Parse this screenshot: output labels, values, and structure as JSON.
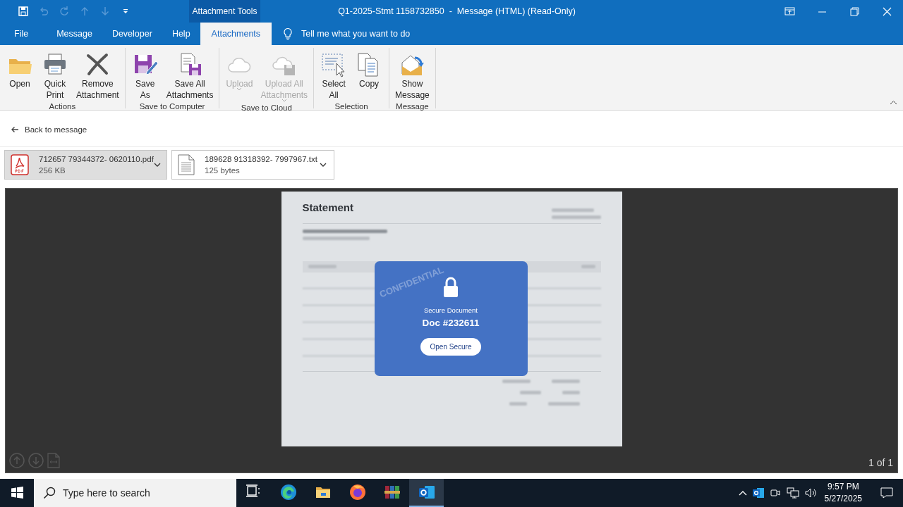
{
  "window": {
    "title": "Q1-2025-Stmt 1158732850  -  Message (HTML) (Read-Only)",
    "context_tab_group": "Attachment Tools"
  },
  "quick_access": [
    {
      "disabled": false
    },
    {
      "disabled": true
    },
    {
      "disabled": true
    },
    {
      "disabled": true
    },
    {
      "disabled": true
    },
    {
      "disabled": false
    }
  ],
  "tabs": [
    {
      "label": "File",
      "selected": false
    },
    {
      "label": "Message",
      "selected": false
    },
    {
      "label": "Developer",
      "selected": false
    },
    {
      "label": "Help",
      "selected": false
    },
    {
      "label": "Attachments",
      "selected": true
    }
  ],
  "tell_me": {
    "placeholder": "Tell me what you want to do"
  },
  "ribbon_groups": [
    {
      "label": "Actions",
      "buttons": [
        {
          "label": "Open",
          "disabled": false,
          "dropdown": false
        },
        {
          "label": "Quick Print",
          "disabled": false,
          "dropdown": false
        },
        {
          "label": "Remove Attachment",
          "disabled": false,
          "dropdown": false
        }
      ]
    },
    {
      "label": "Save to Computer",
      "buttons": [
        {
          "label": "Save As",
          "disabled": false,
          "dropdown": false
        },
        {
          "label": "Save All Attachments",
          "disabled": false,
          "dropdown": false
        }
      ]
    },
    {
      "label": "Save to Cloud",
      "buttons": [
        {
          "label": "Upload",
          "disabled": true,
          "dropdown": true
        },
        {
          "label": "Upload All Attachments",
          "disabled": true,
          "dropdown": true
        }
      ]
    },
    {
      "label": "Selection",
      "buttons": [
        {
          "label": "Select All",
          "disabled": false,
          "dropdown": false
        },
        {
          "label": "Copy",
          "disabled": false,
          "dropdown": false
        }
      ]
    },
    {
      "label": "Message",
      "buttons": [
        {
          "label": "Show Message",
          "disabled": false,
          "dropdown": false
        }
      ]
    }
  ],
  "back_link": "Back to message",
  "attachments": [
    {
      "kind": "pdf",
      "name": "712657 79344372- 0620110.pdf",
      "size": "256 KB",
      "selected": true
    },
    {
      "kind": "text",
      "name": "189628 91318392- 7997967.txt",
      "size": "125 bytes",
      "selected": false
    }
  ],
  "preview": {
    "document": {
      "title": "Statement",
      "watermark": "CONFIDENTIAL",
      "dialog": {
        "label": "Secure Document",
        "doc_number": "Doc #232611",
        "button": "Open Secure"
      }
    },
    "page_counter": "1 of 1"
  },
  "taskbar": {
    "search": {
      "placeholder": "Type here to search"
    },
    "apps": [
      {
        "selected": false
      },
      {
        "selected": false
      },
      {
        "selected": false
      },
      {
        "selected": false
      },
      {
        "selected": false
      },
      {
        "selected": true
      }
    ],
    "time": "9:57 PM",
    "date": "5/27/2025"
  }
}
